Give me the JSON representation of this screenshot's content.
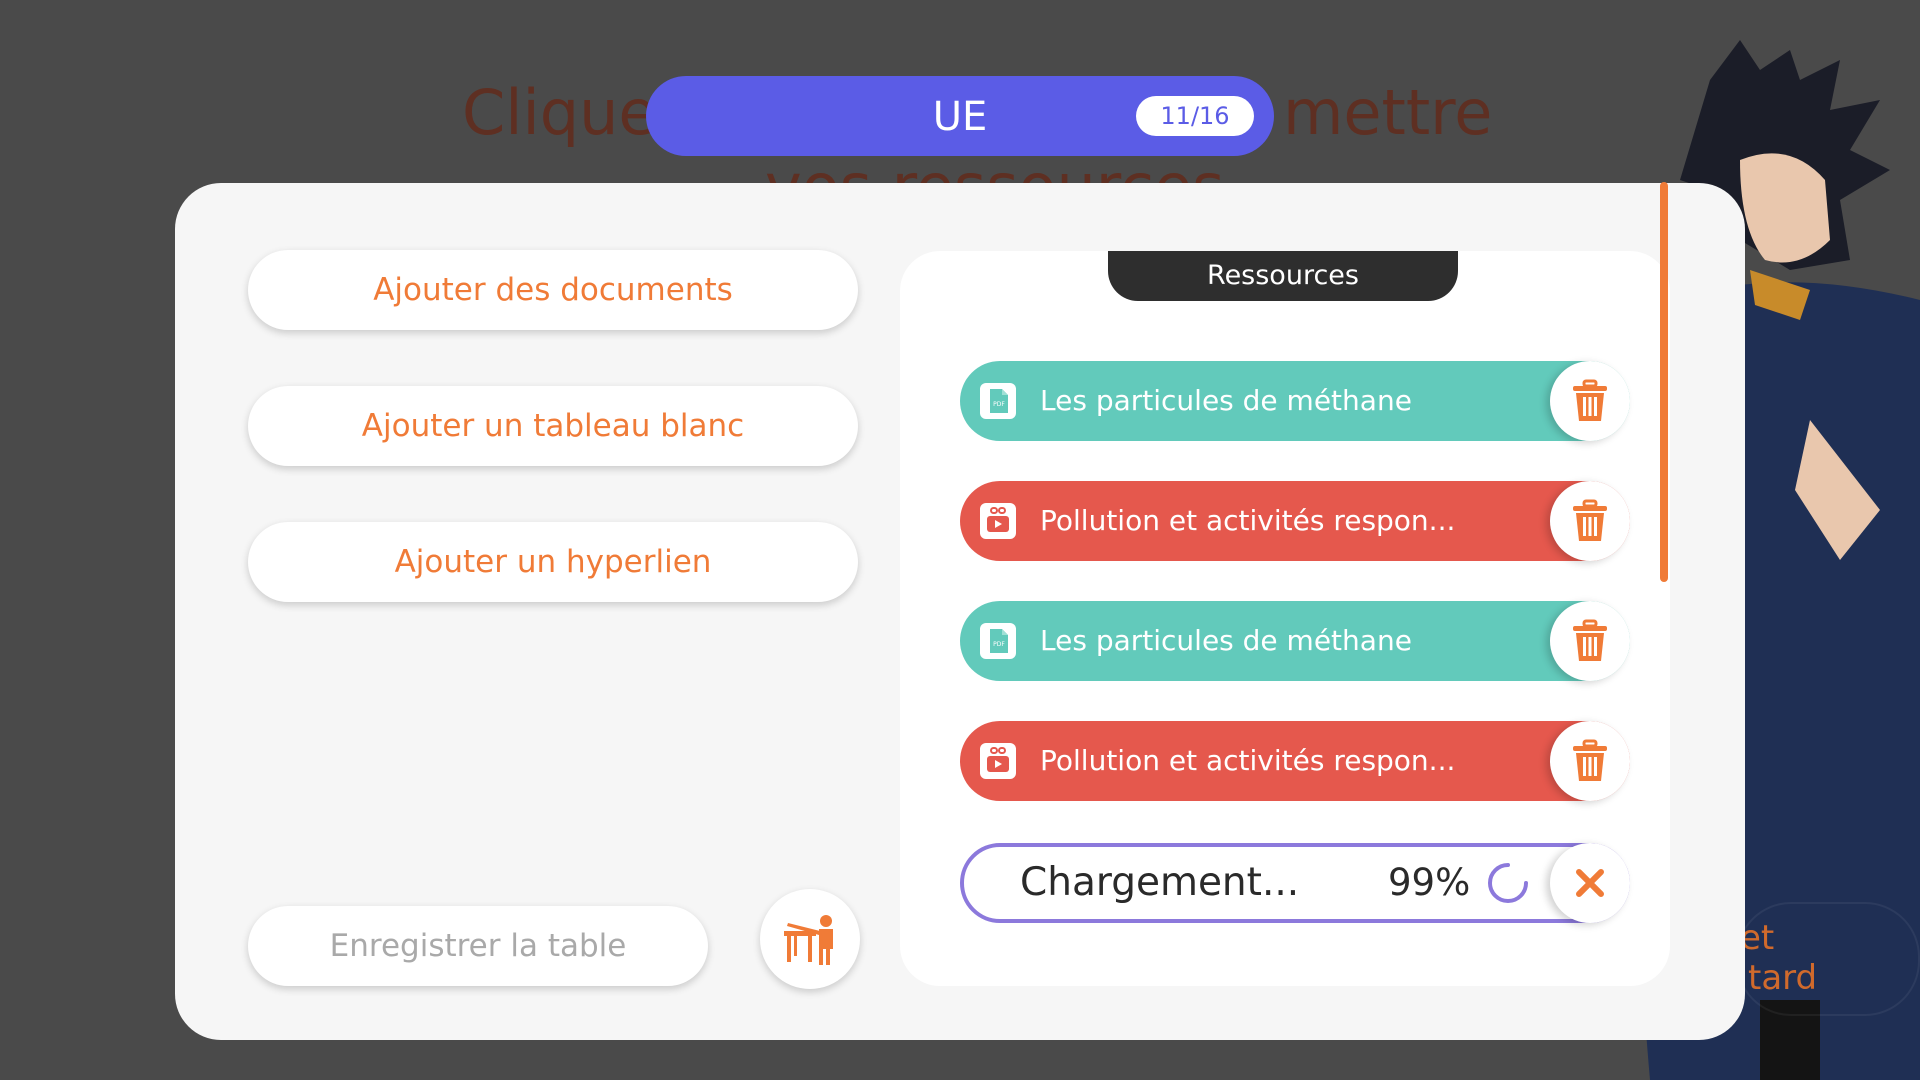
{
  "background": {
    "title_left": "Cliquez",
    "title_right": "mettre",
    "title_line2": "vos ressources",
    "ghost_line1": "et",
    "ghost_line2": "tard"
  },
  "header": {
    "title": "UE",
    "progress_badge": "11/16"
  },
  "modal": {
    "buttons": {
      "add_documents": "Ajouter des documents",
      "add_whiteboard": "Ajouter un tableau blanc",
      "add_hyperlink": "Ajouter un hyperlien",
      "save_table": "Enregistrer la table"
    },
    "resources_panel": {
      "tab_label": "Ressources",
      "items": [
        {
          "label": "Les particules de méthane",
          "type": "pdf",
          "color": "#62cabb"
        },
        {
          "label": "Pollution et activités respon...",
          "type": "video-link",
          "color": "#e5584d"
        },
        {
          "label": "Les particules de méthane",
          "type": "pdf",
          "color": "#62cabb"
        },
        {
          "label": "Pollution et activités respon...",
          "type": "video-link",
          "color": "#e5584d"
        }
      ],
      "loading": {
        "label": "Chargement...",
        "percent": "99%"
      }
    }
  },
  "colors": {
    "accent": "#f07b37",
    "primary": "#5b5ce6",
    "teal": "#62cabb",
    "red": "#e5584d",
    "loading_border": "#8c79dc"
  }
}
